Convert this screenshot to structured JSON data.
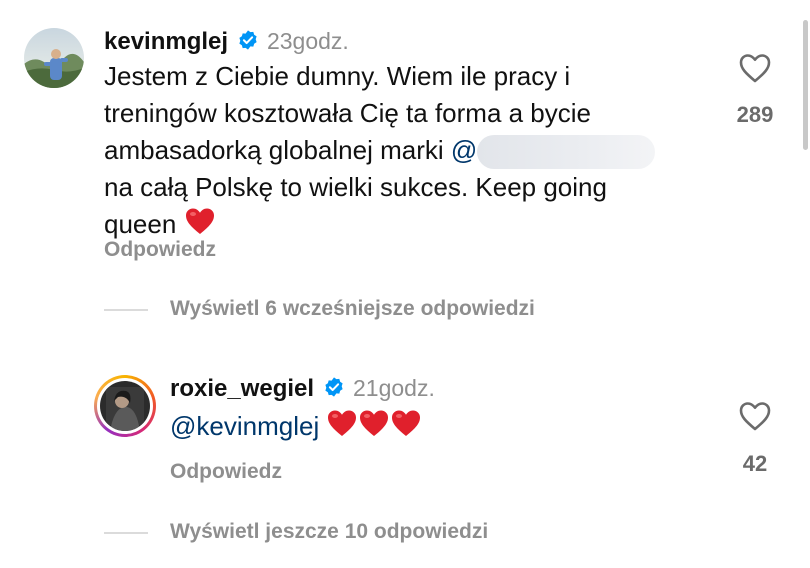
{
  "comment": {
    "username": "kevinmglej",
    "time": "23godz.",
    "text_line1": "Jestem z Ciebie dumny. Wiem ile pracy i",
    "text_line2": "treningów kosztowała Cię ta forma a bycie",
    "text_line3_prefix": "ambasadorką globalnej marki ",
    "text_line3_at": "@",
    "text_line4": "na całą Polskę to wielki sukces. Keep going",
    "text_line5": "queen",
    "likes": "289",
    "reply_label": "Odpowiedz"
  },
  "view_earlier": "Wyświetl 6 wcześniejsze odpowiedzi",
  "reply": {
    "username": "roxie_wegiel",
    "time": "21godz.",
    "mention": "@kevinmglej",
    "likes": "42",
    "reply_label": "Odpowiedz"
  },
  "view_more": "Wyświetl jeszcze 10 odpowiedzi",
  "colors": {
    "verified": "#0095f6",
    "heart": "#e0202c",
    "muted": "#8e8e8e",
    "mention": "#00376b"
  },
  "icons": [
    "verified-badge-icon",
    "heart-outline-icon",
    "red-heart-emoji"
  ]
}
